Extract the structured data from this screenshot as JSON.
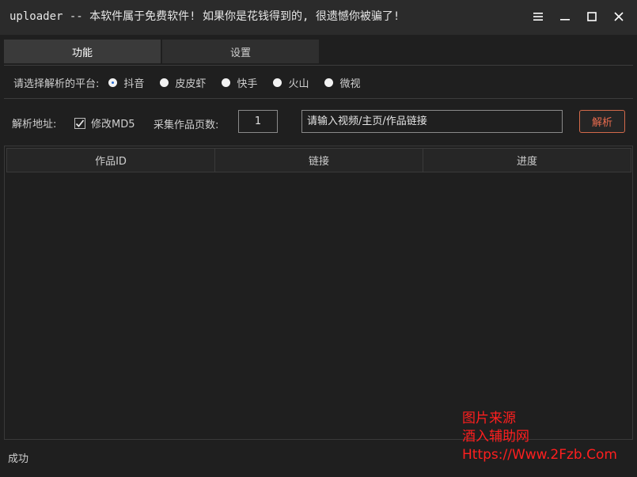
{
  "window": {
    "title": "uploader -- 本软件属于免费软件! 如果你是花钱得到的, 很遗憾你被骗了!"
  },
  "tabs": [
    {
      "label": "功能",
      "active": true
    },
    {
      "label": "设置",
      "active": false
    }
  ],
  "platform": {
    "label": "请选择解析的平台:",
    "options": [
      {
        "label": "抖音",
        "checked": true
      },
      {
        "label": "皮皮虾",
        "checked": false
      },
      {
        "label": "快手",
        "checked": false
      },
      {
        "label": "火山",
        "checked": false
      },
      {
        "label": "微视",
        "checked": false
      }
    ]
  },
  "address": {
    "label": "解析地址:",
    "md5_label": "修改MD5",
    "md5_checked": true,
    "pages_label": "采集作品页数:",
    "pages_value": "1",
    "url_placeholder": "请输入视频/主页/作品链接",
    "parse_button": "解析"
  },
  "table": {
    "columns": [
      "作品ID",
      "链接",
      "进度"
    ],
    "rows": []
  },
  "status": {
    "text": "成功"
  },
  "watermark": {
    "line1": "图片来源",
    "line2": "酒入辅助网",
    "line3": "Https://Www.2Fzb.Com"
  },
  "colors": {
    "background": "#1f1f1f",
    "accent": "#e86b4e",
    "watermark": "#ff1f1f"
  }
}
